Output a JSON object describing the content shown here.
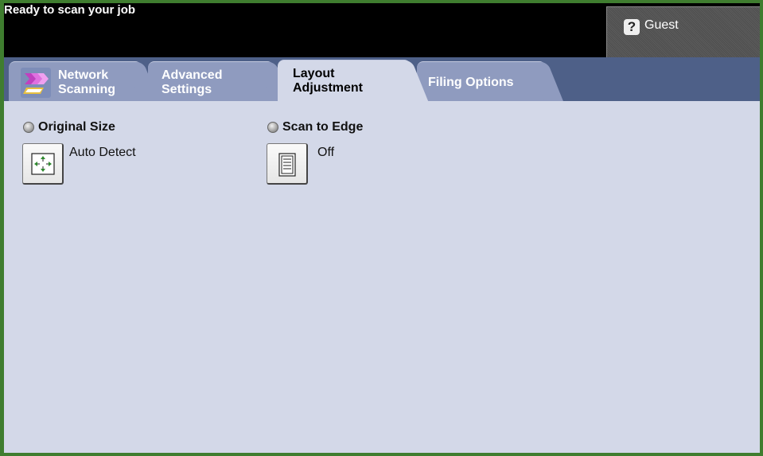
{
  "status": {
    "message": "Ready to scan your job"
  },
  "user": {
    "icon": "help-question-icon",
    "label": "Guest"
  },
  "tabs": [
    {
      "line1": "Network",
      "line2": "Scanning",
      "icon": "network-scanning-icon"
    },
    {
      "line1": "Advanced",
      "line2": "Settings"
    },
    {
      "line1": "Layout",
      "line2": "Adjustment",
      "selected": true
    },
    {
      "line1": "Filing Options",
      "line2": ""
    }
  ],
  "options": {
    "original_size": {
      "title": "Original Size",
      "value": "Auto Detect",
      "icon": "auto-detect-size-icon"
    },
    "scan_to_edge": {
      "title": "Scan to Edge",
      "value": "Off",
      "icon": "scan-to-edge-page-icon"
    }
  },
  "colors": {
    "frame": "#3f7d2f",
    "tab_bar": "#4e6088",
    "tab": "#8f9bbf",
    "active_tab": "#d3d8e8",
    "panel": "#d3d8e8"
  }
}
